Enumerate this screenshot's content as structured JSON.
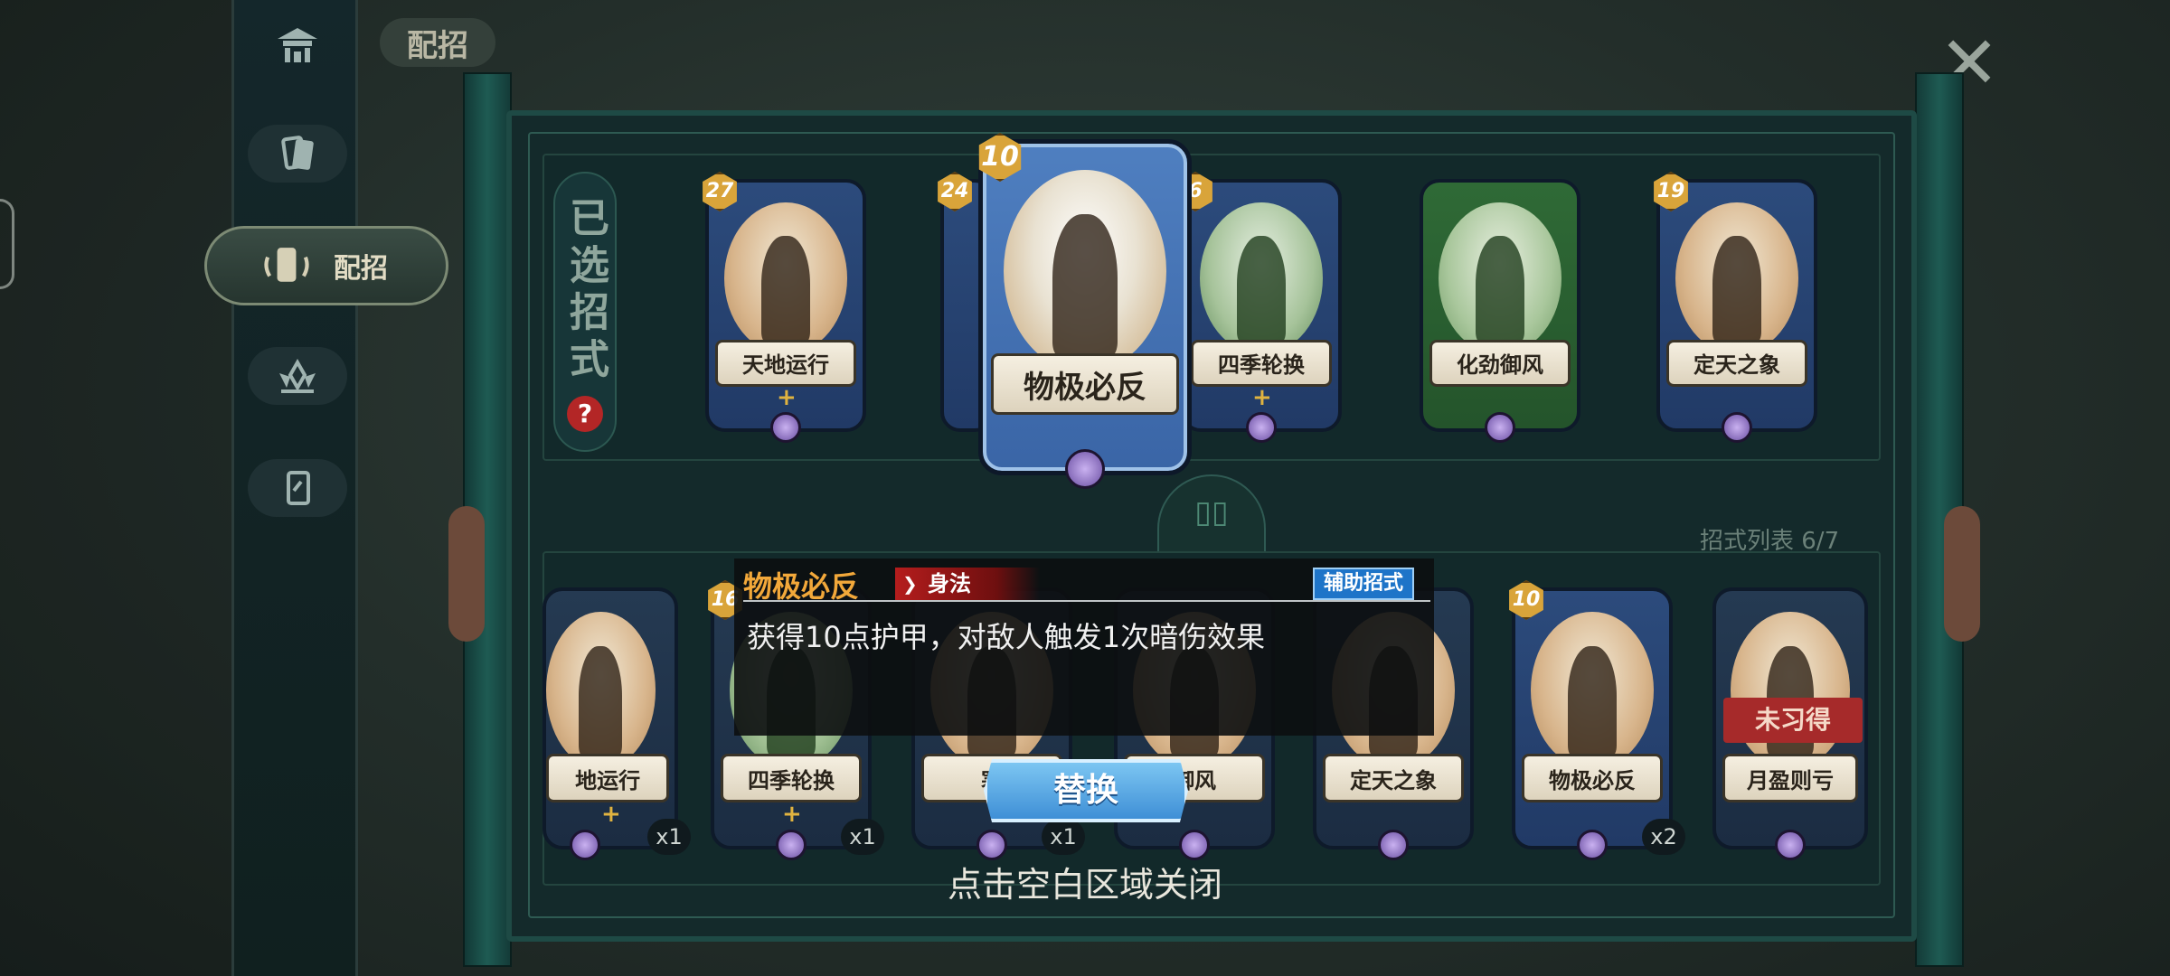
{
  "header": {
    "title": "配招"
  },
  "nav": {
    "items": [
      {
        "name": "pavilion",
        "label": ""
      },
      {
        "name": "cards",
        "label": ""
      },
      {
        "name": "peizhao",
        "label": "配招"
      },
      {
        "name": "flower",
        "label": ""
      },
      {
        "name": "card-single",
        "label": ""
      }
    ]
  },
  "selected_panel": {
    "label": "已选招式",
    "help": "?"
  },
  "list_panel": {
    "count_label": "招式列表 6/7"
  },
  "selected_cards": [
    {
      "name": "天地运行",
      "cost": "27",
      "color": "blue",
      "plus": "+"
    },
    {
      "name": "",
      "cost": "24",
      "color": "blue",
      "plus": ""
    },
    {
      "name": "四季轮换",
      "cost": "6",
      "color": "blue",
      "plus": "+"
    },
    {
      "name": "化劲御风",
      "cost": "",
      "color": "green",
      "plus": ""
    },
    {
      "name": "定天之象",
      "cost": "19",
      "color": "blue",
      "plus": ""
    }
  ],
  "highlight_card": {
    "name": "物极必反",
    "cost": "10"
  },
  "list_cards": [
    {
      "name": "地运行",
      "cost": "",
      "count": "x1",
      "plus": "+"
    },
    {
      "name": "四季轮换",
      "cost": "16",
      "count": "x1",
      "plus": "+"
    },
    {
      "name": "寒",
      "cost": "",
      "count": "x1",
      "plus": ""
    },
    {
      "name": "御风",
      "cost": "",
      "count": "",
      "plus": ""
    },
    {
      "name": "定天之象",
      "cost": "",
      "count": "",
      "plus": ""
    },
    {
      "name": "物极必反",
      "cost": "10",
      "count": "x2",
      "plus": ""
    },
    {
      "name": "月盈则亏",
      "cost": "",
      "count": "",
      "plus": "",
      "status": "未习得"
    }
  ],
  "tooltip": {
    "name": "物极必反",
    "type": "身法",
    "category": "辅助招式",
    "description": "获得10点护甲，对敌人触发1次暗伤效果"
  },
  "replace_button": {
    "label": "替换"
  },
  "hint": {
    "text": "点击空白区域关闭"
  },
  "close": {
    "icon": "close-icon"
  }
}
